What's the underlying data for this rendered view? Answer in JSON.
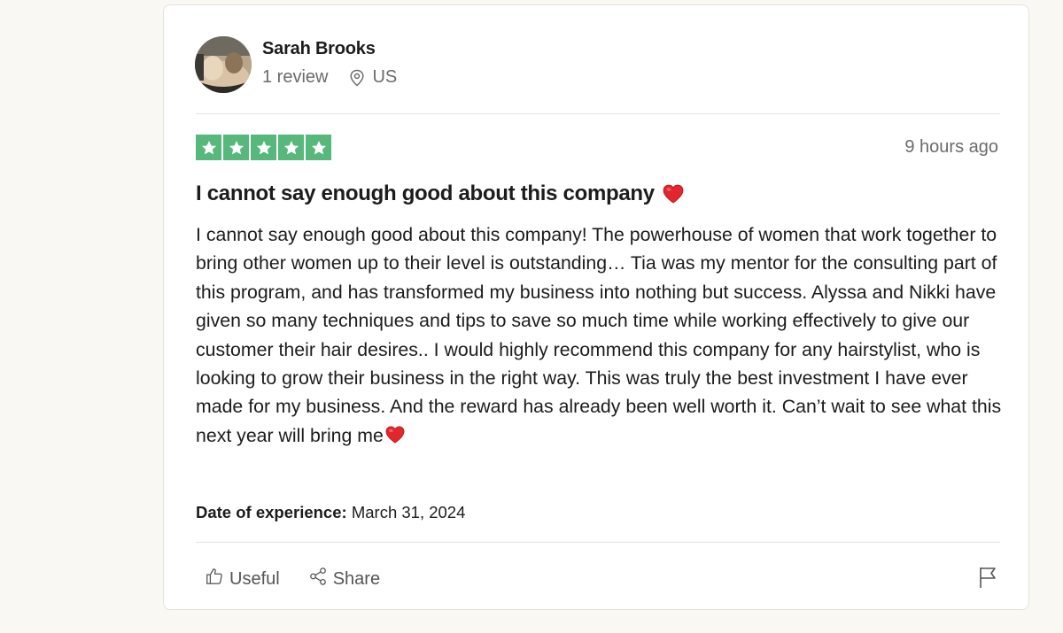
{
  "review": {
    "reviewer": {
      "name": "Sarah Brooks",
      "review_count": "1 review",
      "country": "US"
    },
    "rating": 5,
    "rating_color": "#56b87b",
    "posted": "9 hours ago",
    "title": "I cannot say enough good about this company",
    "body": "I cannot say enough good about this company! The powerhouse of women that work together to bring other women up to their level is outstanding… Tia was my mentor for the consulting part of this program, and has transformed my business into nothing but success. Alyssa and Nikki have given so many techniques and tips to save so much time while working effectively to give our customer their hair desires.. I would highly recommend this company for any hairstylist, who is looking to grow their business in the right way. This was truly the best investment I have ever made for my business. And the reward has already been well worth it. Can’t wait to see what this next year will bring me",
    "experience_label": "Date of experience:",
    "experience_date": "March 31, 2024"
  },
  "actions": {
    "useful_label": "Useful",
    "share_label": "Share"
  },
  "icons": {
    "location": "location-pin-icon",
    "heart": "heart-icon",
    "thumbs_up": "thumbs-up-icon",
    "share": "share-icon",
    "flag": "flag-icon"
  }
}
